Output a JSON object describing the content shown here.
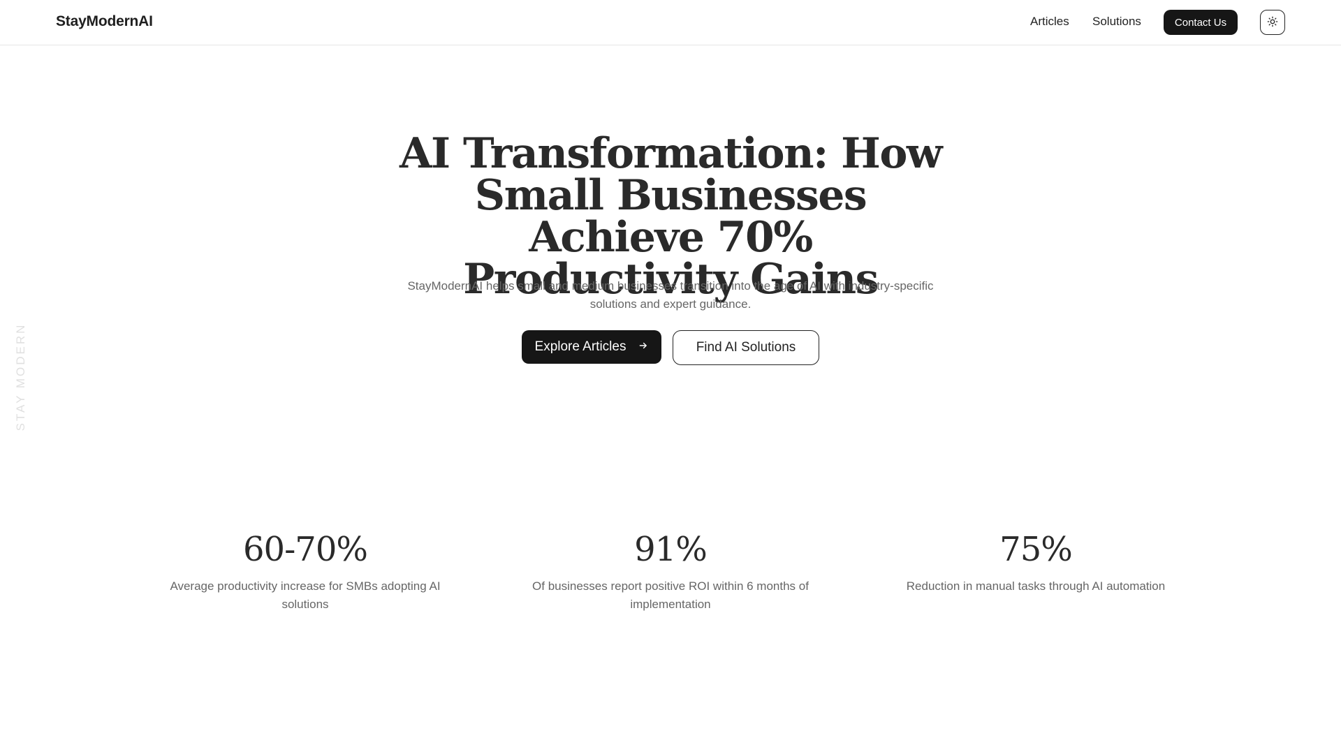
{
  "header": {
    "brand": "StayModernAI",
    "nav": {
      "articles": "Articles",
      "solutions": "Solutions"
    },
    "contact_label": "Contact Us",
    "theme_toggle_icon": "sun-icon"
  },
  "side_label": "STAY MODERN",
  "hero": {
    "title": "AI Transformation: How Small Businesses Achieve 70% Productivity Gains",
    "subtitle": "StayModernAI helps small and medium businesses transition into the age of AI with industry-specific solutions and expert guidance.",
    "primary_button": "Explore Articles",
    "primary_button_icon": "arrow-right-icon",
    "secondary_button": "Find AI Solutions"
  },
  "stats": [
    {
      "value": "60-70%",
      "description": "Average productivity increase for SMBs adopting AI solutions"
    },
    {
      "value": "91%",
      "description": "Of businesses report positive ROI within 6 months of implementation"
    },
    {
      "value": "75%",
      "description": "Reduction in manual tasks through AI automation"
    }
  ],
  "colors": {
    "primary": "#161616",
    "text": "#2a2a2a",
    "muted": "#666666",
    "background": "#ffffff"
  }
}
